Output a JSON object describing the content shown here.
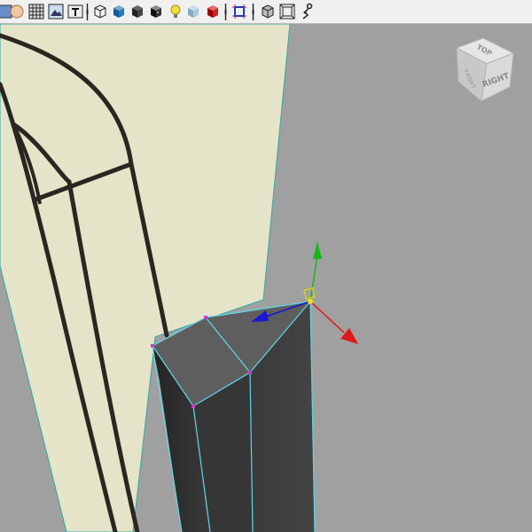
{
  "toolbar": {
    "buttons": [
      {
        "name": "select-mode-icon"
      },
      {
        "name": "shaded-sphere-icon"
      },
      {
        "name": "wireframe-grid-icon"
      },
      {
        "name": "image-plane-icon"
      },
      {
        "name": "text-tool-icon"
      },
      {
        "name": "wireframe-cube-icon"
      },
      {
        "name": "blue-cube-icon"
      },
      {
        "name": "dark-cube-icon"
      },
      {
        "name": "textured-cube-icon"
      },
      {
        "name": "light-bulb-icon"
      },
      {
        "name": "light-blue-cube-icon"
      },
      {
        "name": "red-cube-icon"
      },
      {
        "name": "isolate-select-icon"
      },
      {
        "name": "xray-cube-icon"
      },
      {
        "name": "film-gate-icon"
      },
      {
        "name": "joints-icon"
      }
    ]
  },
  "viewcube": {
    "top_label": "TOP",
    "right_label": "RIGHT",
    "front_label": "FRONT"
  },
  "colors": {
    "viewport_background": "#a0a0a0",
    "image_plane": "#e6e4c8",
    "sketch_lines": "#2a2620",
    "mesh_dark": "#3c3c3c",
    "mesh_edges": "#5fd8e8",
    "vertex": "#c040d0",
    "axis_x": "#e01818",
    "axis_y": "#18b818",
    "axis_z": "#1818d0",
    "pivot": "#e8e020"
  }
}
